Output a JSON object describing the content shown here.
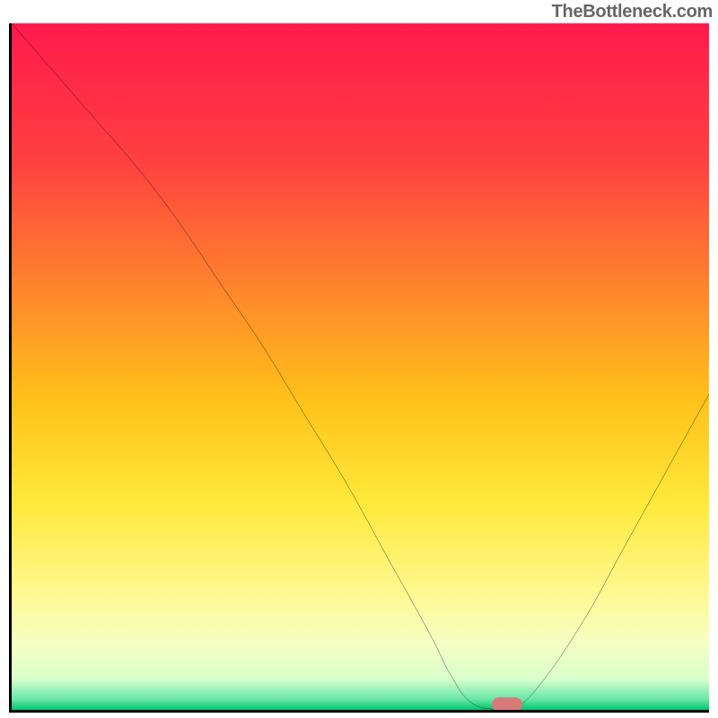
{
  "attribution": "TheBottleneck.com",
  "chart_data": {
    "type": "line",
    "title": "",
    "xlabel": "",
    "ylabel": "",
    "xlim": [
      0,
      100
    ],
    "ylim": [
      0,
      100
    ],
    "grid": false,
    "legend": false,
    "annotations": [],
    "background_gradient": {
      "type": "vertical",
      "stops": [
        {
          "pos": 0.0,
          "color": "#ff1a4d"
        },
        {
          "pos": 0.2,
          "color": "#ff4040"
        },
        {
          "pos": 0.4,
          "color": "#ff8a2b"
        },
        {
          "pos": 0.55,
          "color": "#ffc21a"
        },
        {
          "pos": 0.7,
          "color": "#ffe93b"
        },
        {
          "pos": 0.82,
          "color": "#fff78a"
        },
        {
          "pos": 0.9,
          "color": "#f6ffc2"
        },
        {
          "pos": 0.955,
          "color": "#d9ffcc"
        },
        {
          "pos": 0.985,
          "color": "#66e6a6"
        },
        {
          "pos": 1.0,
          "color": "#00c46a"
        }
      ]
    },
    "series": [
      {
        "name": "bottleneck-curve",
        "color": "#000000",
        "x": [
          0,
          6,
          12,
          18,
          24,
          30,
          36,
          42,
          48,
          54,
          60,
          63,
          66,
          70,
          72,
          76,
          82,
          88,
          94,
          100
        ],
        "y": [
          100,
          93,
          86,
          79,
          71,
          62,
          53,
          43,
          33,
          22,
          11,
          5,
          1,
          0,
          0,
          4,
          13,
          24,
          35,
          46
        ]
      }
    ],
    "marker": {
      "x": 71,
      "y": 0.8,
      "shape": "pill",
      "color": "#d67a7a"
    }
  }
}
